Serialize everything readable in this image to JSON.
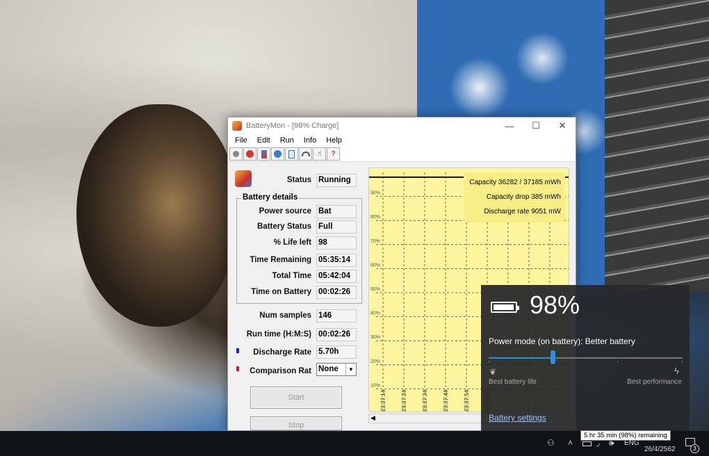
{
  "window": {
    "title": "BatteryMon - [98% Charge]",
    "min": "—",
    "max": "☐",
    "close": "✕"
  },
  "menu": [
    "File",
    "Edit",
    "Run",
    "Info",
    "Help"
  ],
  "toolbar_icons": [
    "record-icon",
    "stop-icon",
    "battery-icon",
    "globe-icon",
    "clipboard-icon",
    "gauge-icon",
    "pointer-icon",
    "help-icon"
  ],
  "status": {
    "label": "Status",
    "value": "Running"
  },
  "battery_details": {
    "title": "Battery details",
    "rows": [
      {
        "label": "Power source",
        "value": "Bat"
      },
      {
        "label": "Battery Status",
        "value": "Full"
      },
      {
        "label": "% Life left",
        "value": "98"
      },
      {
        "label": "Time Remaining",
        "value": "05:35:14"
      },
      {
        "label": "Total Time",
        "value": "05:42:04"
      },
      {
        "label": "Time on Battery",
        "value": "00:02:26"
      }
    ]
  },
  "samples": {
    "label": "Num samples",
    "value": "146"
  },
  "run_time": {
    "label": "Run time (H:M:S)",
    "value": "00:02:26"
  },
  "discharge": {
    "label": "Discharge Rate",
    "value": "5.70h",
    "color": "#1a1ad0"
  },
  "comparison": {
    "label": "Comparison Rat",
    "value": "None",
    "color": "#d01a1a"
  },
  "buttons": {
    "start": "Start",
    "stop": "Stop"
  },
  "chart_data": {
    "type": "line",
    "y_ticks": [
      "90%",
      "80%",
      "70%",
      "60%",
      "50%",
      "40%",
      "30%",
      "20%",
      "10%"
    ],
    "x_ticks": [
      "23:37:14",
      "23:37:24",
      "23:37:34",
      "23:37:44",
      "23:37:54",
      "23:38:04"
    ],
    "legend": [
      "Capacity 36282 / 37185 mWh",
      "Capacity drop 385 mWh",
      "Discharge rate 9051 mW"
    ],
    "series": [
      {
        "values": [
          98,
          98,
          98,
          98,
          98,
          98
        ]
      }
    ],
    "ylim": [
      0,
      100
    ],
    "grid": true
  },
  "flyout": {
    "percent": "98%",
    "battery_level": 0.98,
    "power_mode": "Power mode (on battery): Better battery",
    "slider_level": 0.33,
    "left_label": "Best battery life",
    "right_label": "Best performance",
    "settings_link": "Battery settings"
  },
  "tooltip": "5 hr 35 min (98%) remaining",
  "taskbar": {
    "lang": "ENG",
    "date": "26/4/2562",
    "notif_count": "3"
  }
}
